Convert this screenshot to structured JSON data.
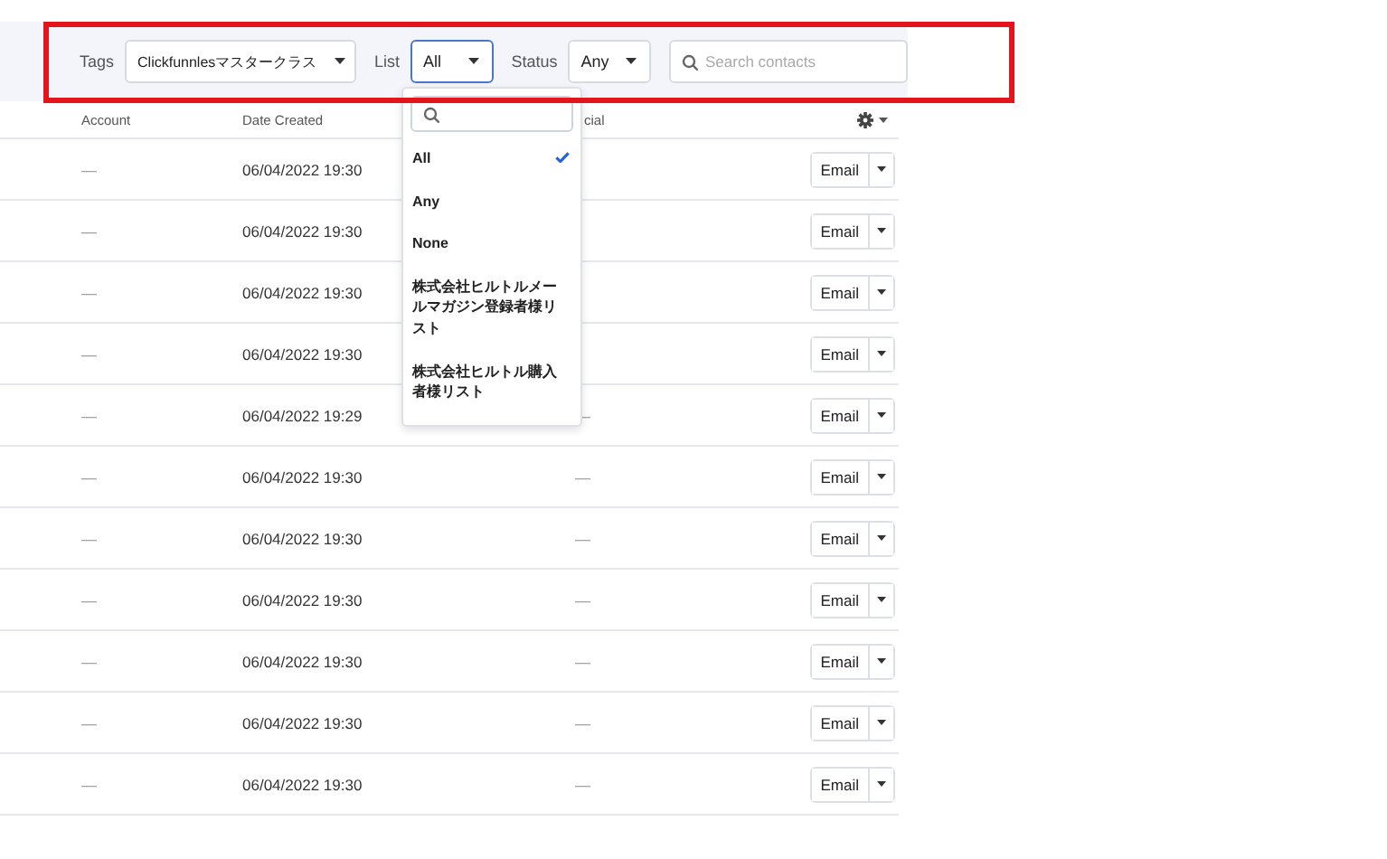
{
  "filters": [
    {
      "kind": "select",
      "label": "Tags",
      "value": "Clickfunnlesマスタークラス",
      "open": false
    },
    {
      "kind": "select",
      "label": "List",
      "value": "All",
      "open": true
    },
    {
      "kind": "select",
      "label": "Status",
      "value": "Any",
      "open": false
    },
    {
      "kind": "search",
      "placeholder": "Search contacts"
    }
  ],
  "list_dropdown": {
    "items": [
      {
        "label": "All",
        "selected": true
      },
      {
        "label": "Any",
        "selected": false
      },
      {
        "label": "None",
        "selected": false
      },
      {
        "label": "株式会社ヒルトルメールマガジン登録者様リスト",
        "selected": false
      },
      {
        "label": "株式会社ヒルトル購入者様リスト",
        "selected": false
      }
    ]
  },
  "table": {
    "columns": [
      "Account",
      "Date Created",
      "cial"
    ],
    "rows": [
      {
        "account": "—",
        "date": "06/04/2022 19:30",
        "action": "Email"
      },
      {
        "account": "—",
        "date": "06/04/2022 19:30",
        "action": "Email"
      },
      {
        "account": "—",
        "date": "06/04/2022 19:30",
        "action": "Email"
      },
      {
        "account": "—",
        "date": "06/04/2022 19:30",
        "action": "Email"
      },
      {
        "account": "—",
        "date": "06/04/2022 19:29",
        "social": "—",
        "action": "Email"
      },
      {
        "account": "—",
        "date": "06/04/2022 19:30",
        "social": "—",
        "action": "Email"
      },
      {
        "account": "—",
        "date": "06/04/2022 19:30",
        "social": "—",
        "action": "Email"
      },
      {
        "account": "—",
        "date": "06/04/2022 19:30",
        "social": "—",
        "action": "Email"
      },
      {
        "account": "—",
        "date": "06/04/2022 19:30",
        "social": "—",
        "action": "Email"
      },
      {
        "account": "—",
        "date": "06/04/2022 19:30",
        "social": "—",
        "action": "Email"
      },
      {
        "account": "—",
        "date": "06/04/2022 19:30",
        "social": "—",
        "action": "Email"
      }
    ]
  },
  "highlight": {
    "shown": true
  }
}
